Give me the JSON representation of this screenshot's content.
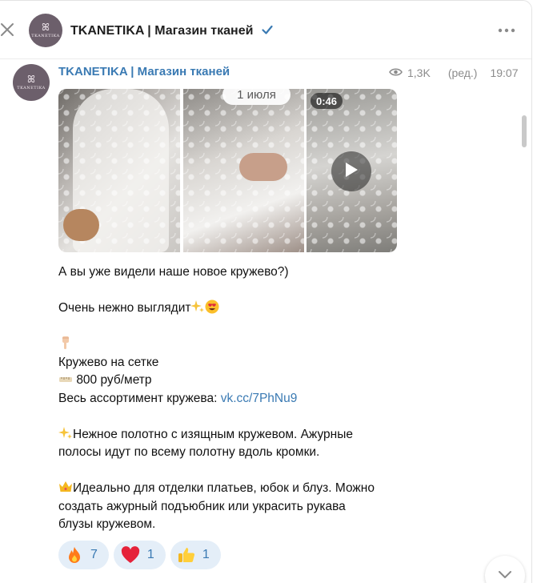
{
  "header": {
    "title": "TKANETIKA | Магазин тканей",
    "avatar_label": "TKANETIKA"
  },
  "post": {
    "channel_name": "TKANETIKA | Магазин тканей",
    "views": "1,3K",
    "edited": "(ред.)",
    "time": "19:07",
    "date_pill": "1 июля",
    "video_duration": "0:46",
    "lines": {
      "l1": "А вы уже видели наше новое кружево?)",
      "l2": "Очень нежно выглядит",
      "l3": "Кружево на сетке",
      "l4": "800 руб/метр",
      "l5_prefix": "Весь ассортимент кружева: ",
      "l5_link": "vk.cc/7PhNu9",
      "l6": "Нежное полотно с изящным кружевом. Ажурные",
      "l7": "полосы идут по всему полотну вдоль кромки.",
      "l8": "Идеально для отделки платьев, юбок и блуз. Можно",
      "l9": "создать ажурный подъюбник или украсить рукава",
      "l10": "блузы кружевом."
    },
    "reactions": [
      {
        "icon": "fire-icon",
        "count": "7"
      },
      {
        "icon": "heart-icon",
        "count": "1"
      },
      {
        "icon": "thumbs-up-icon",
        "count": "1"
      }
    ]
  },
  "colors": {
    "accent": "#3a7ab3",
    "reaction_bg": "#e4eef8",
    "avatar_bg": "#6c5f6b"
  }
}
